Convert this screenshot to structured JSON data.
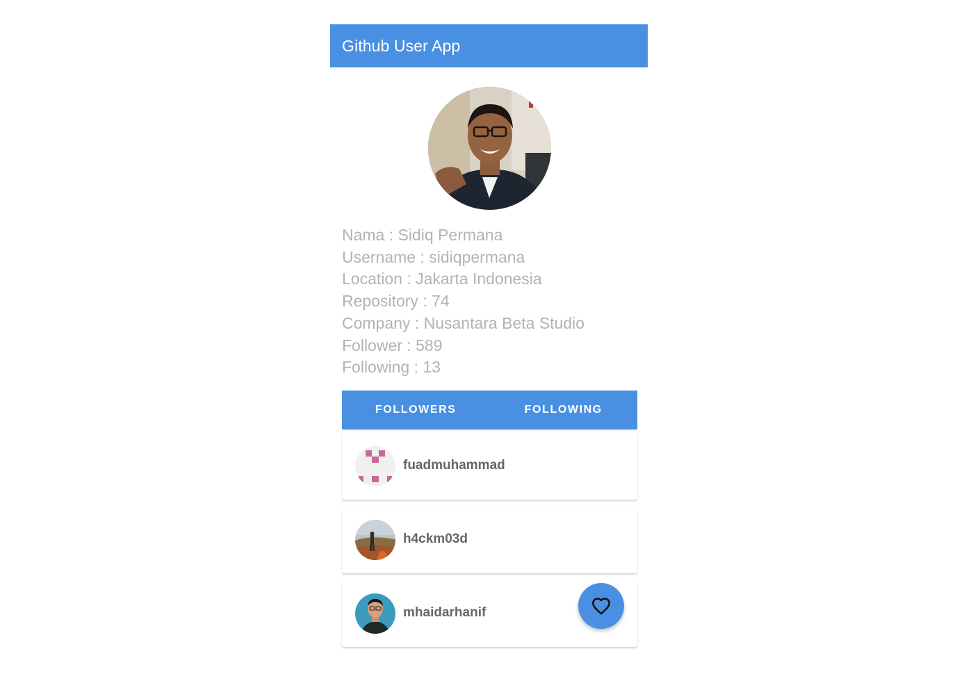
{
  "app_bar": {
    "title": "Github User App"
  },
  "profile": {
    "avatar_icon": "user-photo-avatar",
    "details": [
      "Nama : Sidiq Permana",
      "Username : sidiqpermana",
      "Location : Jakarta Indonesia",
      "Repository : 74",
      "Company : Nusantara Beta Studio",
      "Follower : 589",
      "Following : 13"
    ]
  },
  "tabs": [
    {
      "label": "FOLLOWERS"
    },
    {
      "label": "FOLLOWING"
    }
  ],
  "users": [
    {
      "username": "fuadmuhammad",
      "avatar_icon": "identicon-avatar"
    },
    {
      "username": "h4ckm03d",
      "avatar_icon": "landscape-photo-avatar"
    },
    {
      "username": "mhaidarhanif",
      "avatar_icon": "person-photo-avatar"
    }
  ],
  "fab": {
    "icon": "heart-outline-icon"
  },
  "colors": {
    "primary": "#4a90e2",
    "detail_text": "#b3b3b3",
    "username_text": "#666666"
  }
}
